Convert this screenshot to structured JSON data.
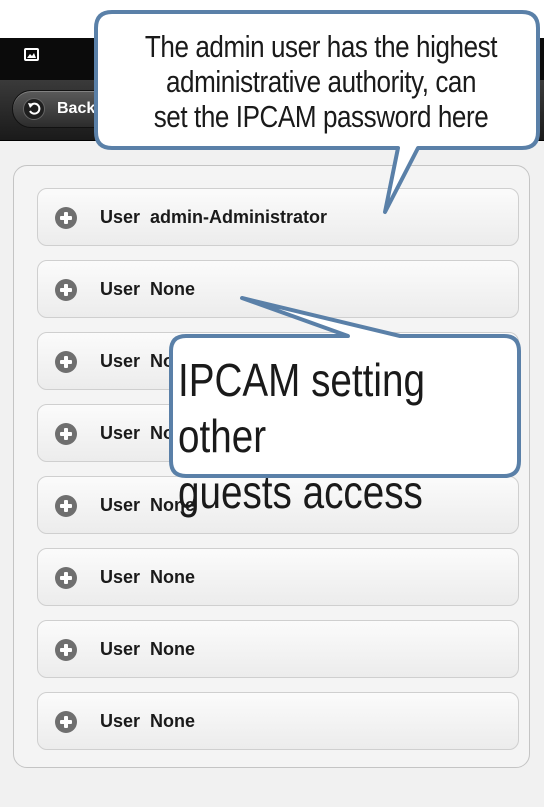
{
  "status_bar": {
    "icon": "gallery-icon"
  },
  "header": {
    "back_label": "Back",
    "back_icon": "back-arrow-icon"
  },
  "users": {
    "items": [
      {
        "label": "User  admin-Administrator"
      },
      {
        "label": "User  None"
      },
      {
        "label": "User  None"
      },
      {
        "label": "User  None"
      },
      {
        "label": "User  None"
      },
      {
        "label": "User  None"
      },
      {
        "label": "User  None"
      },
      {
        "label": "User  None"
      }
    ],
    "item_icon": "plus-icon"
  },
  "callouts": {
    "top": {
      "line1": "The admin user has the highest",
      "line2": "administrative  authority, can",
      "line3": "set the  IPCAM password here"
    },
    "middle": {
      "line1": "IPCAM setting other",
      "line2": "guests access"
    }
  },
  "colors": {
    "callout_fill": "#ffffff",
    "callout_border": "#5a80a8",
    "header_dark": "#1a1a1a",
    "list_bg": "#f4f4f4",
    "plus_icon": "#6f6f6f"
  }
}
